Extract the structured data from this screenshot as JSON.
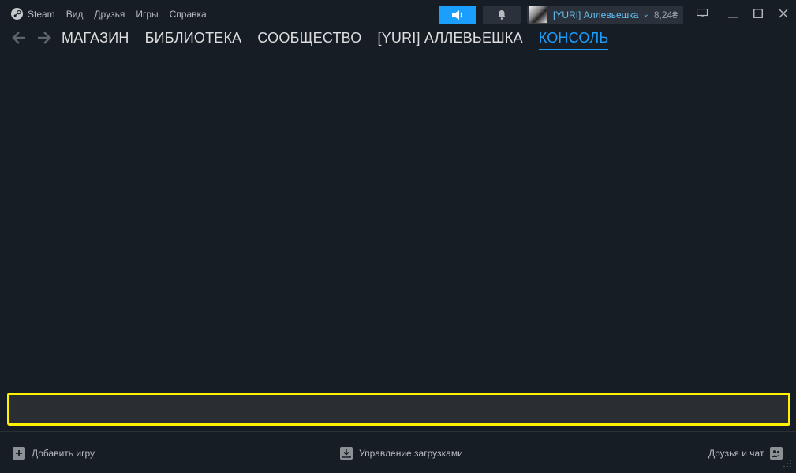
{
  "menu": {
    "app_name": "Steam",
    "items": [
      "Вид",
      "Друзья",
      "Игры",
      "Справка"
    ]
  },
  "account": {
    "name": "[YURI] Аллевьешка",
    "balance": "8,24₴"
  },
  "nav": {
    "links": [
      "МАГАЗИН",
      "БИБЛИОТЕКА",
      "СООБЩЕСТВО",
      "[YURI] АЛЛЕВЬЕШКА",
      "КОНСОЛЬ"
    ],
    "active": "КОНСОЛЬ"
  },
  "console": {
    "input_value": ""
  },
  "bottom": {
    "add_game": "Добавить игру",
    "downloads": "Управление загрузками",
    "friends_chat": "Друзья и чат"
  },
  "colors": {
    "background": "#171d25",
    "accent": "#1a9fff",
    "highlight": "#fff200"
  }
}
